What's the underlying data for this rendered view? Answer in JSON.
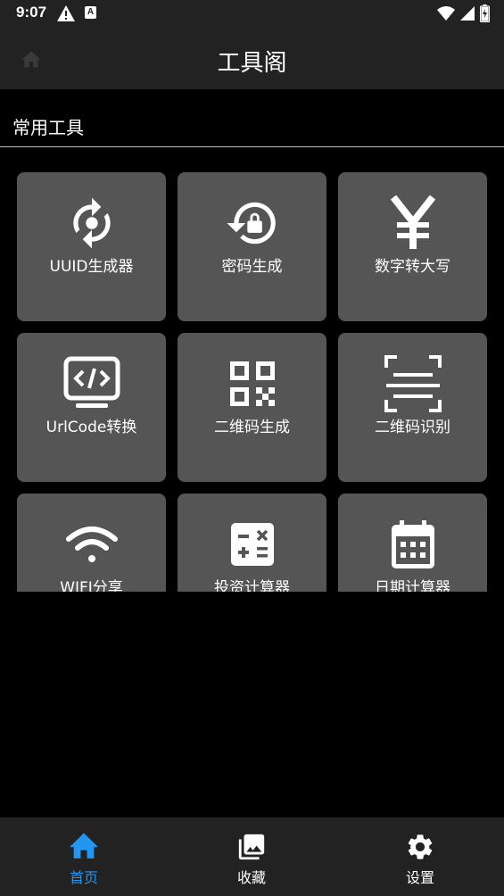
{
  "status_bar": {
    "time": "9:07",
    "icons": [
      "warning-icon",
      "a-icon",
      "wifi-icon",
      "signal-icon",
      "battery-icon"
    ]
  },
  "app_bar": {
    "title": "工具阁",
    "home_icon": "home-icon"
  },
  "section": {
    "title": "常用工具"
  },
  "tools": [
    {
      "label": "UUID生成器",
      "icon": "refresh-icon"
    },
    {
      "label": "密码生成",
      "icon": "lock-reset-icon"
    },
    {
      "label": "数字转大写",
      "icon": "yen-icon"
    },
    {
      "label": "UrlCode转换",
      "icon": "code-monitor-icon"
    },
    {
      "label": "二维码生成",
      "icon": "qrcode-icon"
    },
    {
      "label": "二维码识别",
      "icon": "scan-icon"
    },
    {
      "label": "WIFI分享",
      "icon": "wifi-icon"
    },
    {
      "label": "投资计算器",
      "icon": "calculator-icon"
    },
    {
      "label": "日期计算器",
      "icon": "calendar-icon"
    }
  ],
  "bottom_nav": [
    {
      "label": "首页",
      "icon": "home-icon",
      "active": true
    },
    {
      "label": "收藏",
      "icon": "gallery-icon",
      "active": false
    },
    {
      "label": "设置",
      "icon": "gear-icon",
      "active": false
    }
  ],
  "colors": {
    "active": "#2196F3",
    "inactive": "#ffffff",
    "tile": "#555555",
    "bar": "#222222",
    "background": "#000000"
  }
}
